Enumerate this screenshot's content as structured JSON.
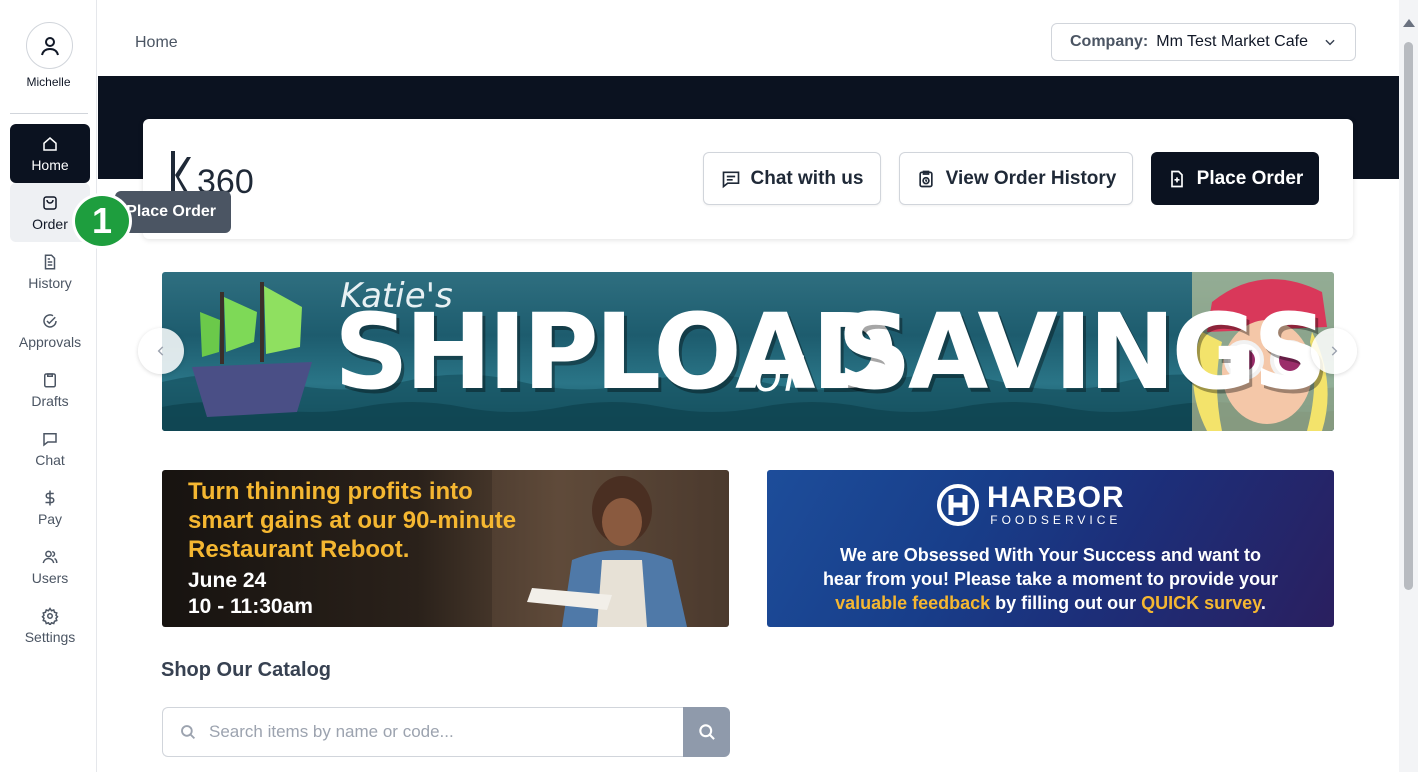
{
  "user": {
    "name": "Michelle"
  },
  "sidebar": {
    "items": [
      {
        "label": "Home",
        "icon": "home-icon"
      },
      {
        "label": "Order",
        "icon": "shopping-bag-icon"
      },
      {
        "label": "History",
        "icon": "document-icon"
      },
      {
        "label": "Approvals",
        "icon": "check-circle-icon"
      },
      {
        "label": "Drafts",
        "icon": "clipboard-icon"
      },
      {
        "label": "Chat",
        "icon": "chat-bubble-icon"
      },
      {
        "label": "Pay",
        "icon": "dollar-icon"
      },
      {
        "label": "Users",
        "icon": "users-icon"
      },
      {
        "label": "Settings",
        "icon": "gear-icon"
      }
    ],
    "active": "Home",
    "hovered": "Order"
  },
  "header": {
    "breadcrumb": "Home",
    "company_label": "Company:",
    "company_value": "Mm Test Market Cafe"
  },
  "tooltip": {
    "text": "Place Order",
    "step": "1"
  },
  "card": {
    "logo_text": "360",
    "chat_label": "Chat with us",
    "history_label": "View Order History",
    "place_order_label": "Place Order"
  },
  "main_banner": {
    "script": "Katie's",
    "word1": "SHIPLOAD",
    "of": "of",
    "word2": "SAVINGS"
  },
  "promo_left": {
    "line1": "Turn thinning profits into",
    "line2": "smart gains at our 90-minute",
    "line3": "Restaurant Reboot.",
    "date": "June 24",
    "time": "10 - 11:30am"
  },
  "promo_right": {
    "brand": "HARBOR",
    "brand_sub": "FOODSERVICE",
    "line1": "We are Obsessed With Your Success and want to",
    "line2": "hear from you! Please take a moment to provide your",
    "line3_a": "valuable feedback",
    "line3_b": " by filling out our ",
    "line3_c": "QUICK survey",
    "line3_d": "."
  },
  "catalog": {
    "title": "Shop Our Catalog",
    "search_placeholder": "Search items by name or code...",
    "search_value": ""
  },
  "colors": {
    "dark": "#0b1220",
    "accent_green": "#1e9e3e",
    "promo_yellow": "#f5b731"
  }
}
